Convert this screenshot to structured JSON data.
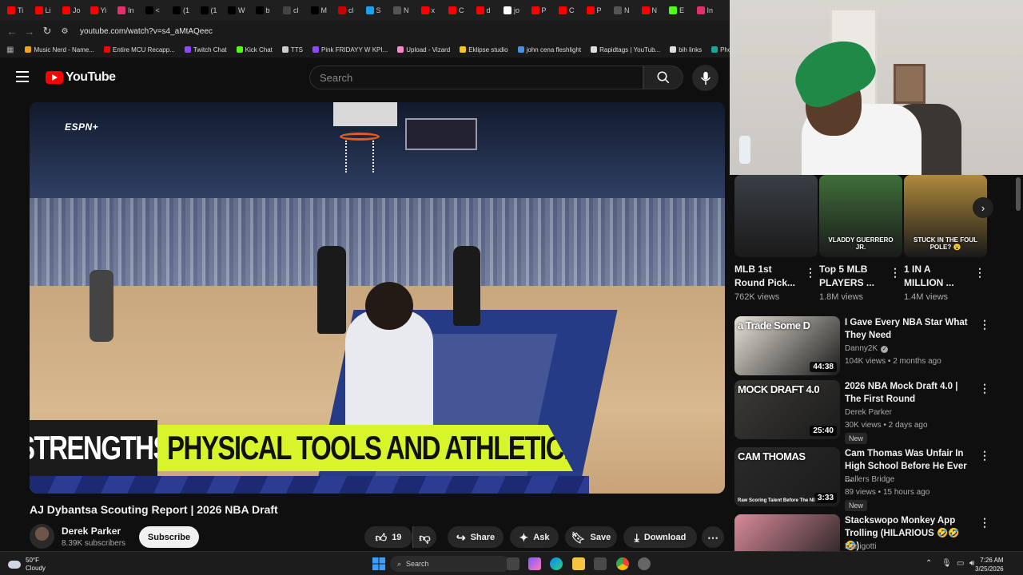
{
  "browser": {
    "tabs": [
      {
        "label": "Ti",
        "color": "#ff0000"
      },
      {
        "label": "Li",
        "color": "#ff0000"
      },
      {
        "label": "Jo",
        "color": "#ff0000"
      },
      {
        "label": "Yi",
        "color": "#ff0000"
      },
      {
        "label": "In",
        "color": "#e1306c"
      },
      {
        "label": "<",
        "color": "#000000"
      },
      {
        "label": "(1",
        "color": "#000000"
      },
      {
        "label": "(1",
        "color": "#000000"
      },
      {
        "label": "W",
        "color": "#000000"
      },
      {
        "label": "b",
        "color": "#000000"
      },
      {
        "label": "cl",
        "color": "#444444"
      },
      {
        "label": "M",
        "color": "#000000"
      },
      {
        "label": "cl",
        "color": "#cc0000"
      },
      {
        "label": "S",
        "color": "#1da1f2"
      },
      {
        "label": "N",
        "color": "#555555"
      },
      {
        "label": "x",
        "color": "#ff0000"
      },
      {
        "label": "C",
        "color": "#ff0000"
      },
      {
        "label": "d",
        "color": "#ff0000"
      },
      {
        "label": "jo",
        "color": "#ffffff"
      },
      {
        "label": "P",
        "color": "#ff0000"
      },
      {
        "label": "C",
        "color": "#ff0000"
      },
      {
        "label": "P",
        "color": "#ff0000"
      },
      {
        "label": "N",
        "color": "#555555"
      },
      {
        "label": "N",
        "color": "#ff0000"
      },
      {
        "label": "E",
        "color": "#53fc18"
      },
      {
        "label": "In",
        "color": "#e1306c"
      }
    ],
    "url": "youtube.com/watch?v=s4_aMtAQeec",
    "bookmarks": [
      {
        "label": "Music Nerd - Name...",
        "color": "#f2a31b"
      },
      {
        "label": "Entire MCU Recapp...",
        "color": "#ff0000"
      },
      {
        "label": "Twitch Chat",
        "color": "#9146ff"
      },
      {
        "label": "Kick Chat",
        "color": "#53fc18"
      },
      {
        "label": "TTS",
        "color": "#cccccc"
      },
      {
        "label": "Pink FRIDAYY W KPI...",
        "color": "#9146ff"
      },
      {
        "label": "Upload - Vizard",
        "color": "#ff88cc"
      },
      {
        "label": "Eklipse studio",
        "color": "#f5c518"
      },
      {
        "label": "john cena fleshlight",
        "color": "#4a90e2"
      },
      {
        "label": "Rapidtags | YouTub...",
        "color": "#dddddd"
      },
      {
        "label": "bih links",
        "color": "#dddddd"
      },
      {
        "label": "Photopea",
        "color": "#18a497"
      }
    ]
  },
  "youtube": {
    "logo_text": "YouTube",
    "search_placeholder": "Search"
  },
  "player": {
    "watermark": "ESPN+",
    "banner_left": "STRENGTHS",
    "banner_right": "PHYSICAL TOOLS AND ATHLETICISM"
  },
  "video": {
    "title": "AJ Dybantsa Scouting Report | 2026 NBA Draft",
    "channel": "Derek Parker",
    "subscribers": "8.39K subscribers",
    "subscribe_label": "Subscribe",
    "likes": "19",
    "share_label": "Share",
    "ask_label": "Ask",
    "save_label": "Save",
    "download_label": "Download"
  },
  "shorts": [
    {
      "title": "MLB 1st Round Pick...",
      "views": "762K views",
      "thumb": "#3a3f45"
    },
    {
      "title": "Top 5 MLB PLAYERS ...",
      "views": "1.8M views",
      "thumb": "#3f6e3a",
      "overlay": "VLADDY GUERRERO JR."
    },
    {
      "title": "1 IN A MILLION ...",
      "views": "1.4M views",
      "thumb": "#b08a3c",
      "overlay": "STUCK IN THE FOUL POLE? 😮"
    }
  ],
  "recommended": [
    {
      "title": "I Gave Every NBA Star What They Need",
      "channel": "Danny2K",
      "verified": true,
      "meta": "104K views • 2 months ago",
      "duration": "44:38",
      "thumb_text": "a Trade   Some D",
      "thumb": "#e9e4da",
      "new": false
    },
    {
      "title": "2026 NBA Mock Draft 4.0 | The First Round",
      "channel": "Derek Parker",
      "verified": false,
      "meta": "30K views • 2 days ago",
      "duration": "25:40",
      "thumb_text": "MOCK DRAFT 4.0",
      "thumb": "#3c3a36",
      "new": true
    },
    {
      "title": "Cam Thomas Was Unfair In High School Before He Ever ...",
      "channel": "Ballers Bridge",
      "verified": false,
      "meta": "89 views • 15 hours ago",
      "duration": "3:33",
      "thumb_text": "CAM THOMAS",
      "thumb_sub": "Raw Scoring Talent Before The NBA",
      "thumb": "#2a2a2a",
      "new": true
    },
    {
      "title": "Stackswopo Monkey App Trolling (HILARIOUS 🤣🤣🤣)",
      "channel": "Danigotti",
      "verified": false,
      "meta": "",
      "duration": "",
      "thumb_text": "",
      "thumb": "#d88a9a",
      "new": false
    }
  ],
  "new_label": "New",
  "taskbar": {
    "weather_temp": "50°F",
    "weather_desc": "Cloudy",
    "search_label": "Search",
    "time": "7:26 AM",
    "date": "3/25/2026"
  }
}
